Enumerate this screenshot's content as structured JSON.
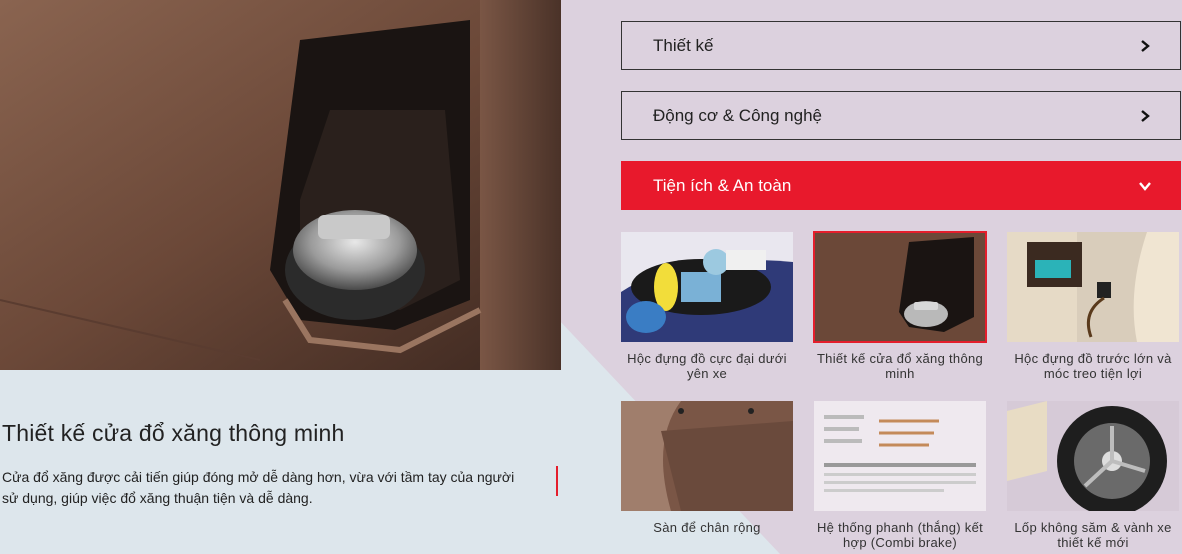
{
  "feature": {
    "title": "Thiết kế cửa đổ xăng thông minh",
    "description": "Cửa đổ xăng được cải tiến giúp đóng mở dễ dàng hơn, vừa với tầm tay của người sử dụng, giúp việc đổ xăng thuận tiện và dễ dàng."
  },
  "accordion": [
    {
      "label": "Thiết kế",
      "icon": "chevron-right-icon"
    },
    {
      "label": "Động cơ & Công nghệ",
      "icon": "chevron-right-icon"
    },
    {
      "label": "Tiện ích & An toàn",
      "icon": "chevron-down-icon"
    }
  ],
  "thumbnails": [
    {
      "caption": "Hộc đựng đồ cực đại dưới yên xe"
    },
    {
      "caption": "Thiết kế cửa đổ xăng thông minh"
    },
    {
      "caption": "Hộc đựng đồ trước lớn và móc treo tiện lợi"
    },
    {
      "caption": "Sàn để chân rộng"
    },
    {
      "caption": "Hệ thống phanh (thắng) kết hợp (Combi brake)"
    },
    {
      "caption": "Lốp không săm & vành xe thiết kế mới"
    }
  ],
  "colors": {
    "accent": "#e8192c",
    "brown": "#6b4a3a"
  }
}
